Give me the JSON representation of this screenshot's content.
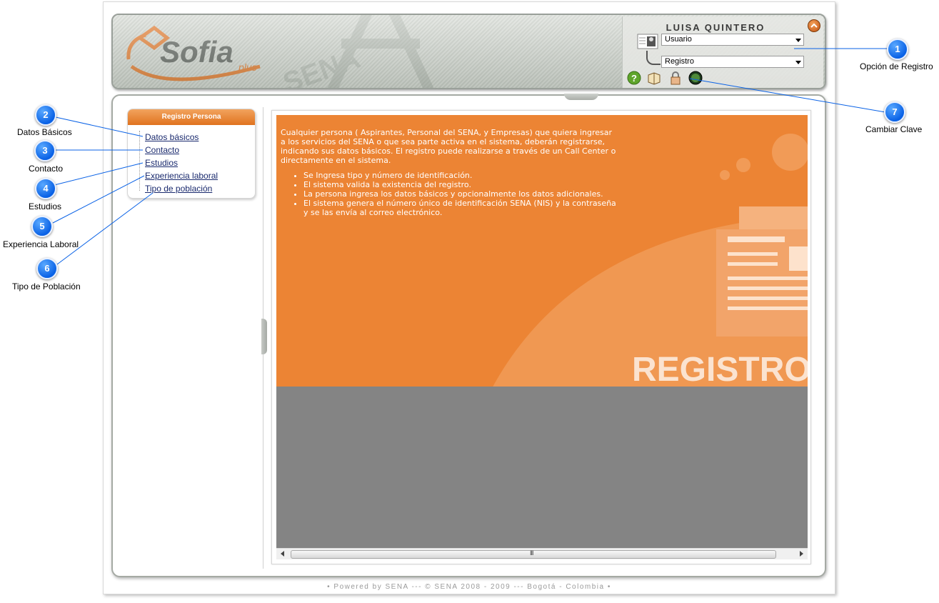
{
  "user": {
    "name": "LUISA QUINTERO",
    "role_select": "Usuario",
    "module_select": "Registro"
  },
  "header": {
    "logo_text": "Sofia",
    "logo_sub": "plus",
    "watermark": "SENA"
  },
  "menu": {
    "title": "Registro Persona",
    "items": [
      {
        "label": "Datos básicos"
      },
      {
        "label": "Contacto"
      },
      {
        "label": "Estudios"
      },
      {
        "label": "Experiencia laboral"
      },
      {
        "label": "Tipo de población"
      }
    ]
  },
  "content": {
    "intro": "Cualquier persona ( Aspirantes, Personal del SENA, y Empresas) que quiera ingresar a los servicios del SENA o que sea parte activa en el sistema, deberán registrarse, indicando sus datos básicos. El registro puede realizarse a través de un Call Center o directamente en el sistema.",
    "bullets": [
      "Se Ingresa tipo y número de identificación.",
      "El sistema valida la existencia del registro.",
      "La persona ingresa los datos básicos y opcionalmente los datos adicionales.",
      "El sistema genera el número único de identificación SENA (NIS) y la contraseña y se las envía al correo electrónico."
    ],
    "banner_word": "REGISTRO"
  },
  "scrollbar": {
    "grip": "III"
  },
  "footer": "• Powered by SENA --- © SENA 2008 - 2009 --- Bogotá - Colombia •",
  "callouts": [
    {
      "num": "1",
      "label": "Opción de Registro"
    },
    {
      "num": "2",
      "label": "Datos Básicos"
    },
    {
      "num": "3",
      "label": "Contacto"
    },
    {
      "num": "4",
      "label": "Estudios"
    },
    {
      "num": "5",
      "label": "Experiencia Laboral"
    },
    {
      "num": "6",
      "label": "Tipo de Población"
    },
    {
      "num": "7",
      "label": "Cambiar Clave"
    }
  ],
  "icons": {
    "close": "close-icon",
    "profile": "user-profile-icon",
    "help": "help-icon",
    "book": "book-icon",
    "lock": "change-password-icon",
    "globe": "globe-icon"
  },
  "colors": {
    "accent_orange": "#ec8434",
    "callout_blue": "#0a62e6",
    "link": "#1a2a6e"
  }
}
